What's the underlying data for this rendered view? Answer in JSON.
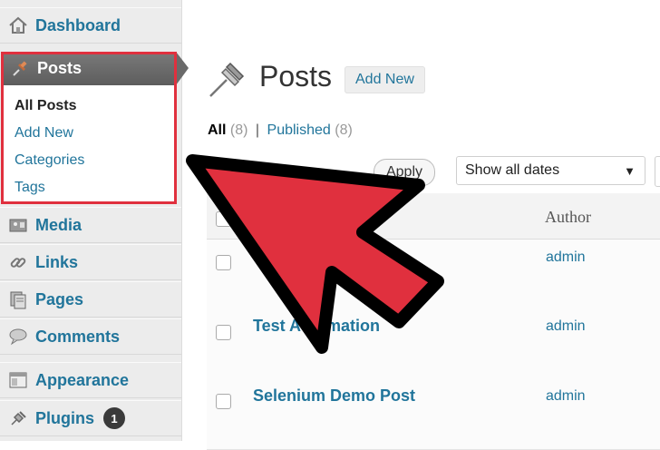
{
  "sidebar": {
    "items": [
      {
        "label": "Dashboard",
        "icon": "home-icon"
      },
      {
        "label": "Posts",
        "icon": "pushpin-icon"
      },
      {
        "label": "Media",
        "icon": "media-icon"
      },
      {
        "label": "Links",
        "icon": "link-icon"
      },
      {
        "label": "Pages",
        "icon": "pages-icon"
      },
      {
        "label": "Comments",
        "icon": "comment-icon"
      },
      {
        "label": "Appearance",
        "icon": "appearance-icon"
      },
      {
        "label": "Plugins",
        "icon": "plugin-icon",
        "badge": "1"
      }
    ],
    "posts_submenu": [
      "All Posts",
      "Add New",
      "Categories",
      "Tags"
    ]
  },
  "main": {
    "title": "Posts",
    "add_new": "Add New",
    "filters": {
      "all_label": "All",
      "all_count": "(8)",
      "separator": "|",
      "published_label": "Published",
      "published_count": "(8)"
    },
    "apply": "Apply",
    "date_select": "Show all dates",
    "columns": {
      "author": "Author"
    },
    "rows": [
      {
        "title": "",
        "author": "admin"
      },
      {
        "title": "Test Automation",
        "author": "admin"
      },
      {
        "title": "Selenium Demo Post",
        "author": "admin"
      }
    ]
  },
  "colors": {
    "highlight": "#e0303e",
    "arrow_fill": "#e0303e",
    "link": "#21759b"
  }
}
